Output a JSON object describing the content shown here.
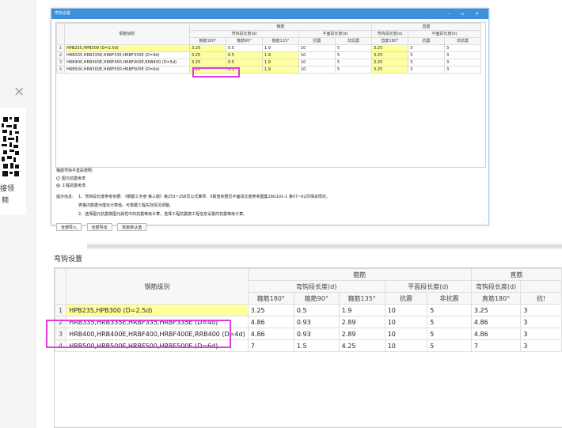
{
  "side": {
    "close": "×",
    "qr_text_1": "接领",
    "qr_text_2": "频"
  },
  "dialog": {
    "title": "弯钩设置",
    "controls": "– ▫ ×",
    "head": {
      "col_label": "钢筋级别",
      "group_a": "箍筋",
      "group_b": "直筋",
      "hook": "弯钩段长度(d)",
      "flat": "平面段长度(d)",
      "h180": "箍筋180°",
      "h90": "箍筋90°",
      "h135": "箍筋135°",
      "seismic": "抗震",
      "nonseismic": "非抗震",
      "z180": "直筋180°"
    },
    "rows": [
      {
        "n": "1",
        "label": "HPB235,HPB300 (D=2.5d)",
        "v": [
          "3.25",
          "0.5",
          "1.9",
          "10",
          "5",
          "3.25",
          "3",
          "3"
        ]
      },
      {
        "n": "2",
        "label": "HRB335,HRB335E,HRBF335,HRBF335E (D=4d)",
        "v": [
          "3.25",
          "0.5",
          "1.9",
          "10",
          "5",
          "3.25",
          "3",
          "3"
        ]
      },
      {
        "n": "3",
        "label": "HRB400,HRB400E,HRBF400,HRBF400E,RRB400 (D=5d)",
        "v": [
          "3.25",
          "0.5",
          "1.9",
          "10",
          "5",
          "3.25",
          "3",
          "3"
        ]
      },
      {
        "n": "4",
        "label": "HRB500,HRB500E,HRBF500,HRBF500E (D=6d)",
        "v": [
          "3.25",
          "0.5",
          "1.9",
          "10",
          "5",
          "3.25",
          "3",
          "3"
        ]
      }
    ],
    "option_title": "箍筋弯钩平直段按照:",
    "option_1": "图元抗震考虑",
    "option_2": "工程抗震考虑",
    "tips_label": "提示信息:",
    "tip_1": "1、弯钩段长度参考依据: 《钢筋工手册 第三版》第253~258页公式推导、0取值依据见平面段长度参考图集16G101-1 第57~62页相关规定。",
    "tip_1b": "表格内数据为理论计算值，可根据工程实际情况调整。",
    "tip_2": "2、选择图元抗震按图元属性中的抗震等级计算，选择工程抗震按工程信息设置的抗震等级计算。",
    "btn_import": "全部导入",
    "btn_export": "全部导出",
    "btn_reset": "恢复默认值"
  },
  "bottom": {
    "title": "弯钩设置",
    "head": {
      "col_label": "钢筋级别",
      "group_a": "箍筋",
      "group_b": "直筋",
      "hook": "弯钩段长度(d)",
      "flat": "平面段长度(d)",
      "h180": "箍筋180°",
      "h90": "箍筋90°",
      "h135": "箍筋135°",
      "seismic": "抗震",
      "nonseismic": "非抗震",
      "z180": "直筋180°",
      "z_seismic": "抗!"
    },
    "rows": [
      {
        "n": "1",
        "label": "HPB235,HPB300 (D=2.5d)",
        "v": [
          "3.25",
          "0.5",
          "1.9",
          "10",
          "5",
          "3.25",
          "3"
        ]
      },
      {
        "n": "2",
        "label": "HRB335,HRB335E,HRBF335,HRBF335E (D=4d)",
        "v": [
          "4.86",
          "0.93",
          "2.89",
          "10",
          "5",
          "4.86",
          "3"
        ]
      },
      {
        "n": "3",
        "label": "HRB400,HRB400E,HRBF400,HRBF400E,RRB400 (D=4d)",
        "v": [
          "4.86",
          "0.93",
          "2.89",
          "10",
          "5",
          "4.86",
          "3"
        ]
      },
      {
        "n": "4",
        "label": "HRB500,HRB500E,HRBF500,HRBF500E (D=6d)",
        "v": [
          "7",
          "1.5",
          "4.25",
          "10",
          "5",
          "7",
          "3"
        ]
      }
    ]
  },
  "colors": {
    "title_bar": "#3c8fd9",
    "highlight": "#e23be0",
    "yellow": "#ffff9c"
  }
}
